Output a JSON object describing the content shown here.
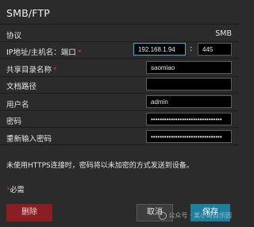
{
  "dialog": {
    "title": "SMB/FTP"
  },
  "form": {
    "protocol": {
      "label": "协议",
      "value": "SMB"
    },
    "host": {
      "label": "IP地址/主机名：端口",
      "ip": "192.168.1.94",
      "separator": ":",
      "port": "445"
    },
    "share": {
      "label": "共享目录名称",
      "value": "saomiao"
    },
    "path": {
      "label": "文档路径",
      "value": ""
    },
    "username": {
      "label": "用户名",
      "value": "admin"
    },
    "password": {
      "label": "密码",
      "value": "••••••••••••••••••••••••••••••••"
    },
    "confirm": {
      "label": "重新输入密码",
      "value": "••••••••••••••••••••••••••••••••"
    }
  },
  "required_mark": "*",
  "notice": "未使用HTTPS连接时，密码将以未加密的方式发送到设备。",
  "required_note": {
    "star": "*",
    "text": "必需"
  },
  "buttons": {
    "delete": "删除",
    "cancel": "取消",
    "save": "保存"
  },
  "watermark": "公众号 · 某小哥自乐园"
}
